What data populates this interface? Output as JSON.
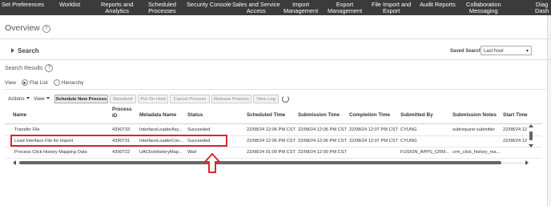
{
  "nav": {
    "items": [
      {
        "label": "Set Preferences",
        "label2": ""
      },
      {
        "label": "Worklist",
        "label2": ""
      },
      {
        "label": "Reports and",
        "label2": "Analytics"
      },
      {
        "label": "Scheduled",
        "label2": "Processes"
      },
      {
        "label": "Security Console",
        "label2": ""
      },
      {
        "label": "Sales and Service",
        "label2": "Access"
      },
      {
        "label": "Import",
        "label2": "Management"
      },
      {
        "label": "Export",
        "label2": "Management"
      },
      {
        "label": "File Import and",
        "label2": "Export"
      },
      {
        "label": "Audit Reports",
        "label2": ""
      },
      {
        "label": "Collaboration",
        "label2": "Messaging"
      },
      {
        "label": "Diag",
        "label2": "Dash"
      }
    ]
  },
  "page": {
    "title": "Overview",
    "search_label": "Search",
    "saved_search_label": "Saved Search",
    "saved_search_value": "Last hour",
    "results_title": "Search Results",
    "view_label": "View",
    "view_options": [
      "Flat List",
      "Hierarchy"
    ]
  },
  "toolbar": {
    "actions": "Actions",
    "view": "View",
    "buttons": [
      "Schedule New Process",
      "Resubmit",
      "Put On Hold",
      "Cancel Process",
      "Release Process",
      "View Log"
    ]
  },
  "table": {
    "columns": [
      "Name",
      "Process ID",
      "Metadata Name",
      "Status",
      "Scheduled Time",
      "Submission Time",
      "Completion Time",
      "Submitted By",
      "Submission Notes",
      "Start Time"
    ],
    "rows": [
      [
        "Transfer File",
        "4390733",
        "InterfaceLoaderAsy...",
        "Succeeded",
        "22/08/24 12:06 PM CST",
        "22/08/24 12:06 PM CST",
        "22/08/24 12:07 PM CST",
        "CYUNG",
        "subrequest submitter",
        "22/08/24 12"
      ],
      [
        "Load Interface File for Import",
        "4390731",
        "InterfaceLoaderCon...",
        "Succeeded",
        "22/08/24 12:06 PM CST",
        "22/08/24 12:06 PM CST",
        "22/08/24 12:07 PM CST",
        "CYUNG",
        "",
        "22/08/24 12"
      ],
      [
        "Process Click History Mapping Data",
        "4390722",
        "UAClickHistoryMap...",
        "Wait",
        "22/08/24 01:00 PM CST",
        "22/08/24 12:00 PM CST",
        "",
        "FUSION_APPS_CRM...",
        "crm_click_history_ma...",
        ""
      ]
    ]
  }
}
